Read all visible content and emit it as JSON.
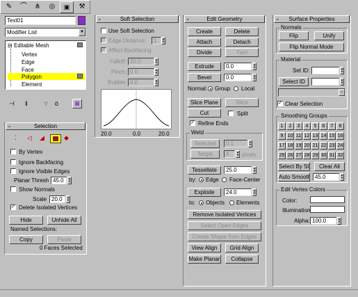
{
  "toolbar": {
    "tabs": [
      {
        "icon": "create-icon"
      },
      {
        "icon": "modify-icon"
      },
      {
        "icon": "hierarchy-icon"
      },
      {
        "icon": "motion-icon"
      },
      {
        "icon": "display-icon"
      },
      {
        "icon": "utilities-icon"
      }
    ]
  },
  "object": {
    "name": "Text01",
    "color": "#8c2bc7"
  },
  "modifier_list": {
    "label": "Modifier List"
  },
  "stack": {
    "items": [
      {
        "label": "Editable Mesh",
        "prefix": "⊟"
      },
      {
        "label": "Vertex"
      },
      {
        "label": "Edge"
      },
      {
        "label": "Face"
      },
      {
        "label": "Polygon"
      },
      {
        "label": "Element"
      }
    ]
  },
  "selection": {
    "title": "Selection",
    "by_vertex": "By Vertex",
    "ignore_backfacing": "Ignore Backfacing",
    "ignore_visible_edges": "Ignore Visible Edges",
    "planar_thresh_label": "Planar Thresh",
    "planar_thresh_value": "45.0",
    "show_normals": "Show Normals",
    "scale_label": "Scale",
    "scale_value": "20.0",
    "delete_isolated": "Delete Isolated Vertices",
    "hide": "Hide",
    "unhide_all": "Unhide All",
    "named_selections": "Named Selections:",
    "copy": "Copy",
    "paste": "Paste",
    "status": "0 Faces Selected"
  },
  "soft_selection": {
    "title": "Soft Selection",
    "use_soft": "Use Soft Selection",
    "edge_distance": "Edge Distance:",
    "edge_distance_value": "1",
    "affect_backfacing": "Affect Backfacing",
    "falloff_label": "Falloff:",
    "falloff_value": "20.0",
    "pinch_label": "Pinch:",
    "pinch_value": "0.0",
    "bubble_label": "Bubble:",
    "bubble_value": "0.0",
    "curve_left": "20.0",
    "curve_mid": "0.0",
    "curve_right": "20.0"
  },
  "edit_geometry": {
    "title": "Edit Geometry",
    "create": "Create",
    "delete": "Delete",
    "attach": "Attach",
    "detach": "Detach",
    "divide": "Divide",
    "turn": "Turn",
    "extrude": "Extrude",
    "extrude_value": "0.0",
    "bevel": "Bevel",
    "bevel_value": "0.0",
    "normal_label": "Normal:",
    "group": "Group",
    "local": "Local",
    "slice_plane": "Slice Plane",
    "slice": "Slice",
    "cut": "Cut",
    "split": "Split",
    "refine_ends": "Refine Ends",
    "weld_label": "Weld",
    "selected": "Selected",
    "selected_value": "0.1",
    "target": "Target",
    "target_value": "4",
    "pixels": "pixels",
    "tessellate": "Tessellate",
    "tessellate_value": "25.0",
    "by_label": "by:",
    "edge": "Edge",
    "face_center": "Face-Center",
    "explode": "Explode",
    "explode_value": "24.0",
    "to_label": "to:",
    "objects": "Objects",
    "elements": "Elements",
    "remove_isolated": "Remove Isolated Vertices",
    "select_open_edges": "Select Open Edges",
    "create_shape": "Create Shape from Edges",
    "view_align": "View Align",
    "grid_align": "Grid Align",
    "make_planar": "Make Planar",
    "collapse": "Collapse"
  },
  "surface_properties": {
    "title": "Surface Properties",
    "normals_label": "Normals",
    "flip": "Flip",
    "unify": "Unify",
    "flip_normal_mode": "Flip Normal Mode",
    "material_label": "Material",
    "set_id": "Set ID:",
    "select_id": "Select ID",
    "clear_selection": "Clear Selection",
    "smoothing_groups_label": "Smoothing Groups",
    "sg": [
      "1",
      "2",
      "3",
      "4",
      "5",
      "6",
      "7",
      "8",
      "9",
      "10",
      "11",
      "12",
      "13",
      "14",
      "15",
      "16",
      "17",
      "18",
      "19",
      "20",
      "21",
      "22",
      "23",
      "24",
      "25",
      "26",
      "27",
      "28",
      "29",
      "30",
      "31",
      "32"
    ],
    "select_by_sg": "Select By SG",
    "clear_all": "Clear All",
    "auto_smooth": "Auto Smooth",
    "auto_smooth_value": "45.0",
    "edit_vertex_colors_label": "Edit Vertex Colors",
    "color": "Color:",
    "illumination": "Illumination:",
    "alpha": "Alpha:",
    "alpha_value": "100.0"
  }
}
